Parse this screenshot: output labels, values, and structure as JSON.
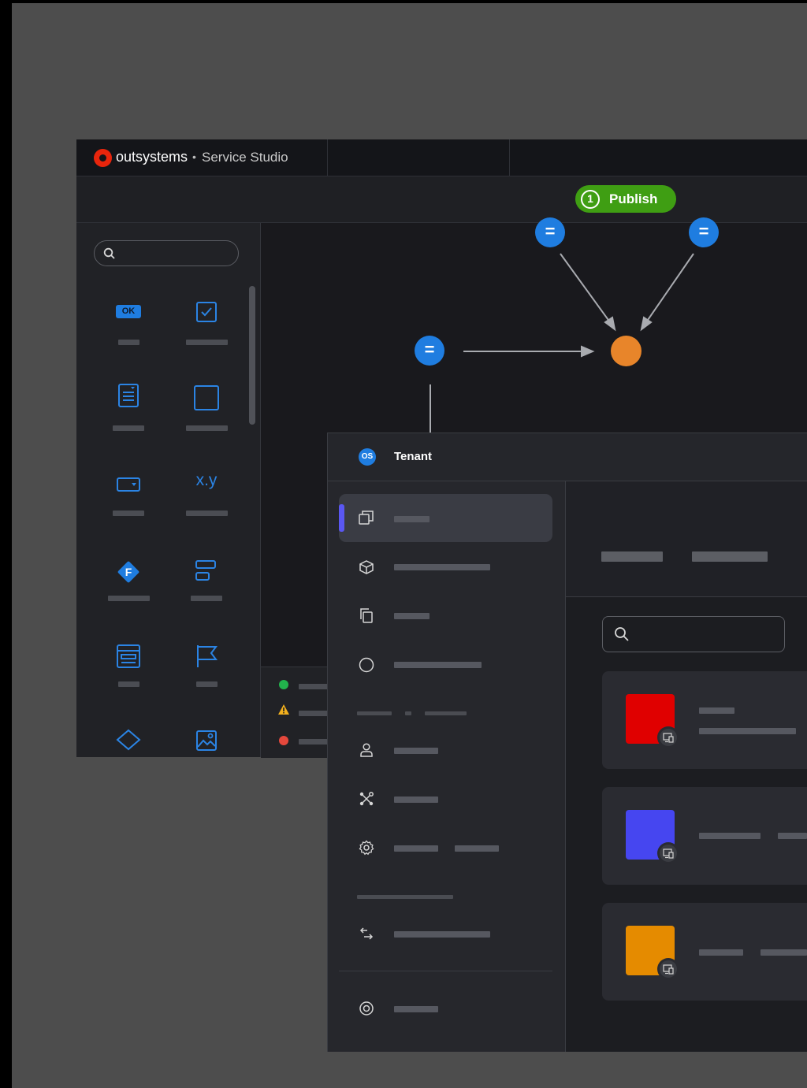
{
  "brand": {
    "logo_name": "outsystems",
    "separator": "•",
    "product": "Service Studio",
    "logo_color": "#e8250c"
  },
  "toolbar": {
    "publish_count": "1",
    "publish_label": "Publish",
    "publish_color": "#3f9e13"
  },
  "toolbox": {
    "ok_label": "OK",
    "variable_label": "x.y",
    "function_label": "F"
  },
  "flow": {
    "node_symbol": "=",
    "node_color": "#1f7de0",
    "target_color": "#e8852a"
  },
  "tenant": {
    "avatar_initials": "OS",
    "title": "Tenant"
  },
  "apps": [
    {
      "color": "#e00000"
    },
    {
      "color": "#4646f0"
    },
    {
      "color": "#e58b00"
    }
  ],
  "status": {
    "ok_color": "#22b24c",
    "warning_color": "#f2b01e",
    "error_color": "#e5483c"
  }
}
